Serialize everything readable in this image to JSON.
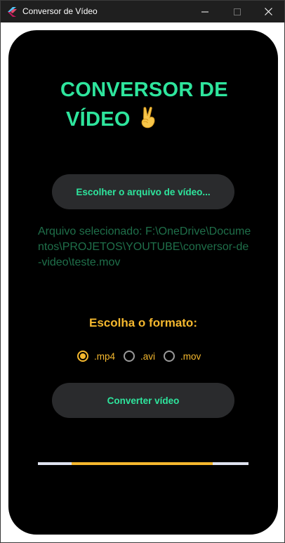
{
  "window": {
    "title": "Conversor de Vídeo"
  },
  "app": {
    "heading_line1": "CONVERSOR DE",
    "heading_line2": "VÍDEO",
    "heading_emoji": "✌",
    "choose_file_label": "Escolher o arquivo de vídeo...",
    "selected_file_text": "Arquivo selecionado: F:\\OneDrive\\Documentos\\PROJETOS\\YOUTUBE\\conversor-de-video\\teste.mov",
    "format_title": "Escolha o formato:",
    "formats": [
      {
        "label": ".mp4",
        "selected": true
      },
      {
        "label": ".avi",
        "selected": false
      },
      {
        "label": ".mov",
        "selected": false
      }
    ],
    "convert_label": "Converter vídeo",
    "progress": {
      "indeterminate": true,
      "segment_start": 0.16,
      "segment_end": 0.83
    }
  },
  "colors": {
    "accent_green": "#2ee59d",
    "accent_yellow": "#f5b82e",
    "file_text": "#1f6f4a",
    "button_bg": "#2a2b2d",
    "progress_track": "#dfe3f0"
  },
  "icons": {
    "app_icon": "flutter-logo-icon",
    "minimize": "minimize-icon",
    "maximize": "maximize-icon",
    "close": "close-icon"
  }
}
